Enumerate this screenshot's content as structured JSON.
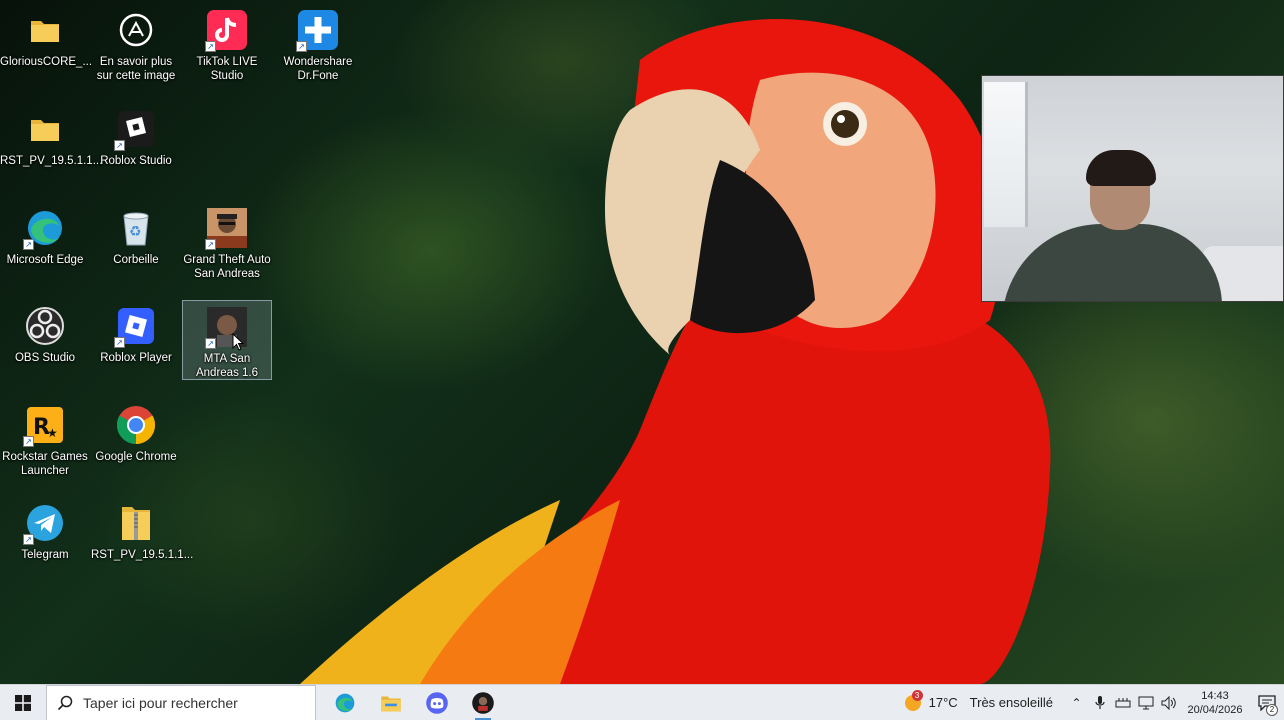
{
  "desktop": {
    "icons": [
      {
        "label": "GloriousCORE_...",
        "icon": "folder-icon"
      },
      {
        "label": "En savoir plus sur cette image",
        "icon": "info-camera-icon"
      },
      {
        "label": "TikTok LIVE Studio",
        "icon": "tiktok-live-icon"
      },
      {
        "label": "Wondershare Dr.Fone",
        "icon": "drfone-icon"
      },
      {
        "label": "RST_PV_19.5.1.1...",
        "icon": "folder-icon"
      },
      {
        "label": "Roblox Studio",
        "icon": "roblox-studio-icon"
      },
      {
        "label": "Microsoft Edge",
        "icon": "edge-icon"
      },
      {
        "label": "Corbeille",
        "icon": "recycle-bin-icon"
      },
      {
        "label": "Grand Theft Auto San Andreas",
        "icon": "gta-sa-icon"
      },
      {
        "label": "OBS Studio",
        "icon": "obs-icon"
      },
      {
        "label": "Roblox Player",
        "icon": "roblox-player-icon"
      },
      {
        "label": "MTA San Andreas 1.6",
        "icon": "mta-icon",
        "selected": true
      },
      {
        "label": "Rockstar Games Launcher",
        "icon": "rockstar-icon"
      },
      {
        "label": "Google Chrome",
        "icon": "chrome-icon"
      },
      {
        "label": "Telegram",
        "icon": "telegram-icon"
      },
      {
        "label": "RST_PV_19.5.1.1...",
        "icon": "zip-folder-icon"
      }
    ]
  },
  "taskbar": {
    "search_placeholder": "Taper ici pour rechercher",
    "pinned": [
      "edge-icon",
      "file-explorer-icon",
      "discord-icon",
      "game-app-icon"
    ],
    "weather": {
      "temp": "17°C",
      "condition": "Très ensoleillé",
      "badge": "3"
    },
    "clock": {
      "time": "14:43",
      "date": "20/04/2026"
    },
    "notifications_count": "2"
  },
  "colors": {
    "taskbar_bg": "#e9ecf1",
    "selection_bg": "rgba(180,200,220,0.22)",
    "accent": "#4a90d9"
  }
}
